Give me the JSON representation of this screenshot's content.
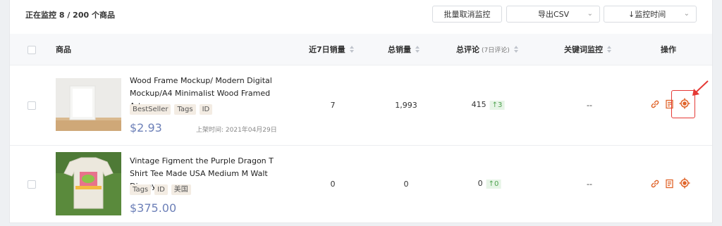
{
  "toolbar": {
    "monitor_count": "正在监控 8 / 200 个商品",
    "batch_cancel_label": "批量取消监控",
    "export_label": "导出CSV",
    "sort_label": "↓监控时间"
  },
  "table": {
    "headers": {
      "product": "商品",
      "sales_7d": "近7日销量",
      "total_sales": "总销量",
      "total_reviews": "总评论",
      "reviews_sub": "(7日评论)",
      "keyword_monitor": "关键词监控",
      "actions": "操作"
    },
    "rows": [
      {
        "title": "Wood Frame Mockup/ Modern Digital Mockup/A4 Minimalist Wood Framed Art...",
        "tags": [
          "BestSeller",
          "Tags",
          "ID"
        ],
        "price": "$2.93",
        "listed": "上架时间: 2021年04月29日",
        "sales_7d": "7",
        "total_sales": "1,993",
        "reviews": "415",
        "reviews_delta": "↑3",
        "keyword_monitor": "--"
      },
      {
        "title": "Vintage Figment the Purple Dragon T Shirt Tee Made USA Medium M Walt Disney...",
        "tags": [
          "Tags",
          "ID",
          "美国"
        ],
        "price": "$375.00",
        "sales_7d": "0",
        "total_sales": "0",
        "reviews": "0",
        "reviews_delta": "↑0",
        "keyword_monitor": "--"
      }
    ]
  },
  "colors": {
    "accent": "#e0652b",
    "price": "#6d80b8",
    "positive": "#4ea24e",
    "highlight": "#e53935"
  },
  "icons": [
    "link-icon",
    "report-icon",
    "target-icon",
    "chevron-down-icon",
    "sort-icon"
  ]
}
